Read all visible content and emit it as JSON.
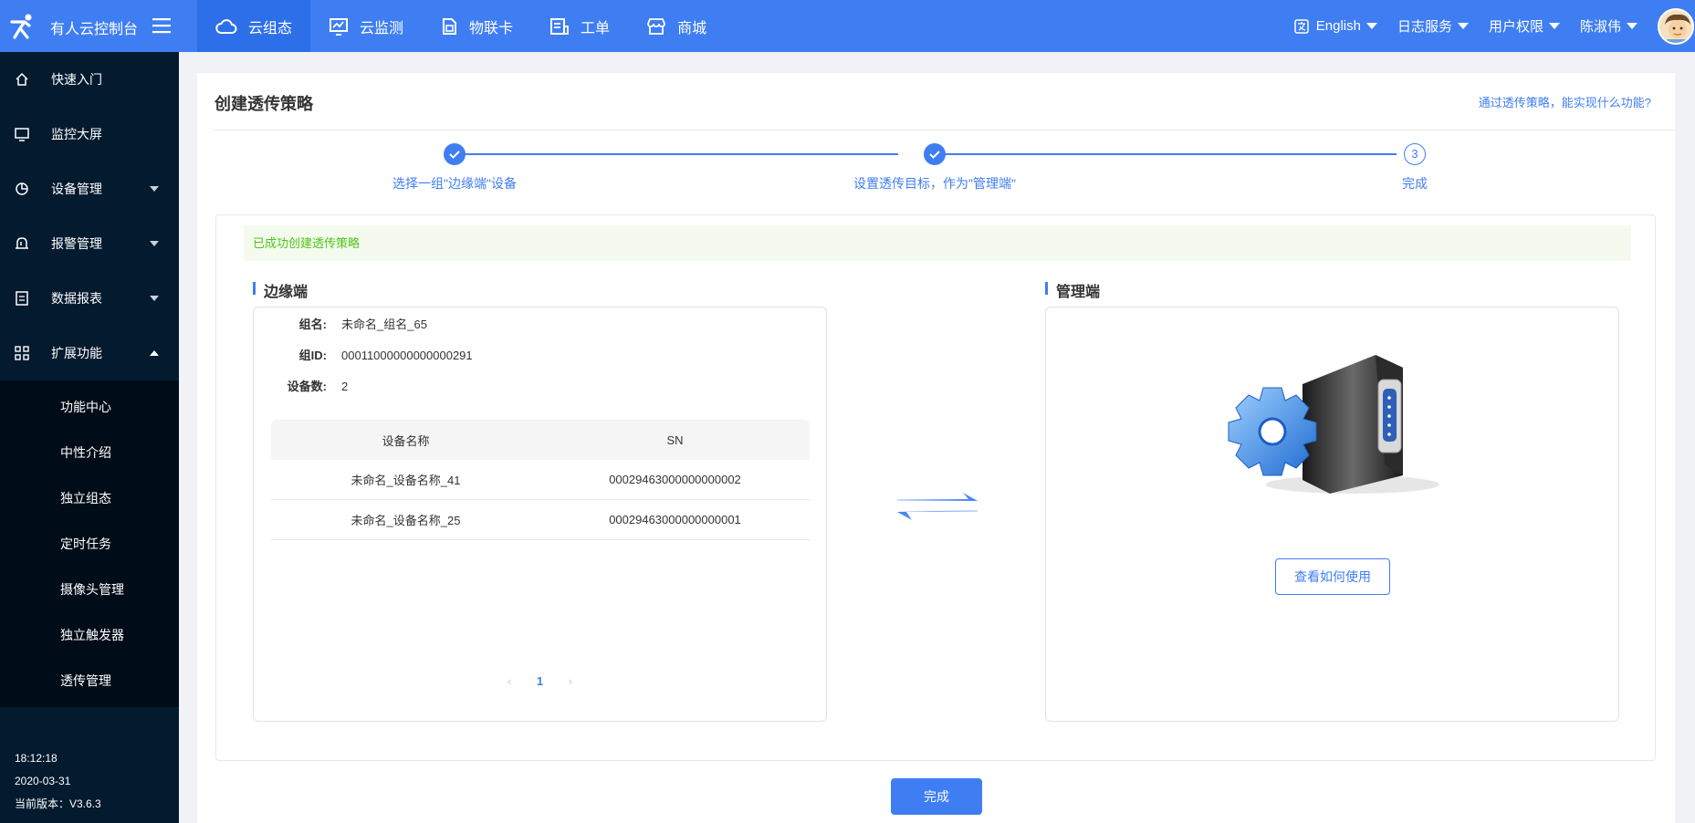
{
  "app": {
    "title": "有人云控制台",
    "nav": [
      {
        "label": "云组态",
        "icon": "cloud-icon",
        "active": true
      },
      {
        "label": "云监测",
        "icon": "monitor-chart-icon",
        "active": false
      },
      {
        "label": "物联卡",
        "icon": "sim-card-icon",
        "active": false
      },
      {
        "label": "工单",
        "icon": "document-icon",
        "active": false
      },
      {
        "label": "商城",
        "icon": "store-icon",
        "active": false
      }
    ],
    "language": "English",
    "log_service": "日志服务",
    "user_permission": "用户权限",
    "user_name": "陈淑伟"
  },
  "sidebar": {
    "items": [
      {
        "label": "快速入门",
        "icon": "home-icon"
      },
      {
        "label": "监控大屏",
        "icon": "screen-icon"
      },
      {
        "label": "设备管理",
        "icon": "device-icon"
      },
      {
        "label": "报警管理",
        "icon": "bell-icon"
      },
      {
        "label": "数据报表",
        "icon": "report-icon"
      },
      {
        "label": "扩展功能",
        "icon": "grid-icon"
      }
    ],
    "submenu": [
      "功能中心",
      "中性介绍",
      "独立组态",
      "定时任务",
      "摄像头管理",
      "独立触发器",
      "透传管理"
    ],
    "time": "18:12:18",
    "date": "2020-03-31",
    "version": "当前版本：V3.6.3"
  },
  "page": {
    "title": "创建透传策略",
    "help_link": "通过透传策略，能实现什么功能?",
    "steps": [
      {
        "label": "选择一组\"边缘端\"设备",
        "status": "done"
      },
      {
        "label": "设置透传目标，作为\"管理端\"",
        "status": "done"
      },
      {
        "label": "完成",
        "status": "current",
        "number": "3"
      }
    ],
    "success_message": "已成功创建透传策略",
    "edge": {
      "title": "边缘端",
      "group_name_label": "组名:",
      "group_name": "未命名_组名_65",
      "group_id_label": "组ID:",
      "group_id": "00011000000000000291",
      "device_count_label": "设备数:",
      "device_count": "2",
      "table": {
        "headers": [
          "设备名称",
          "SN"
        ],
        "rows": [
          [
            "未命名_设备名称_41",
            "00029463000000000002"
          ],
          [
            "未命名_设备名称_25",
            "00029463000000000001"
          ]
        ]
      },
      "pager": {
        "prev": "‹",
        "current": "1",
        "next": "›"
      }
    },
    "manager": {
      "title": "管理端",
      "how_to_button": "查看如何使用"
    },
    "finish_button": "完成"
  },
  "colors": {
    "primary": "#3f7ef2",
    "sidebar_bg": "#041a2f",
    "success_text": "#52c41a"
  }
}
